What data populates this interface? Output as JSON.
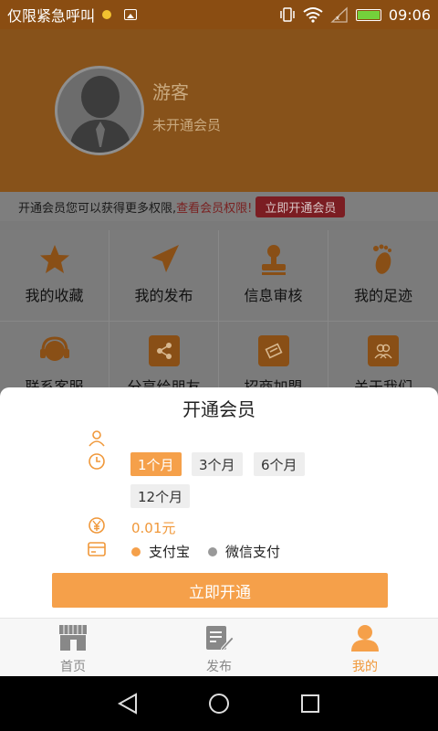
{
  "status_bar": {
    "notification_text": "仅限紧急呼叫",
    "time": "09:06",
    "icons": [
      "notification-dot-icon",
      "image-icon",
      "vibrate-icon",
      "wifi-icon",
      "signal-icon",
      "battery-charging-icon"
    ]
  },
  "profile": {
    "name": "游客",
    "membership_status": "未开通会员"
  },
  "promo": {
    "text": "开通会员您可以获得更多权限,",
    "link": "查看会员权限!",
    "button": "立即开通会员"
  },
  "grid": {
    "items": [
      {
        "label": "我的收藏",
        "icon": "star-icon"
      },
      {
        "label": "我的发布",
        "icon": "send-arrow-icon"
      },
      {
        "label": "信息审核",
        "icon": "stamp-icon"
      },
      {
        "label": "我的足迹",
        "icon": "footprint-icon"
      },
      {
        "label": "联系客服",
        "icon": "headset-icon"
      },
      {
        "label": "分享给朋友",
        "icon": "share-icon"
      },
      {
        "label": "招商加盟",
        "icon": "handshake-icon"
      },
      {
        "label": "关于我们",
        "icon": "group-icon"
      }
    ]
  },
  "modal": {
    "title": "开通会员",
    "months": [
      "1个月",
      "3个月",
      "6个月",
      "12个月"
    ],
    "selected_month": "1个月",
    "price": "0.01元",
    "payment_options": [
      "支付宝",
      "微信支付"
    ],
    "selected_payment": "支付宝",
    "submit": "立即开通",
    "row_icons": [
      "user-icon",
      "clock-icon",
      "yen-icon",
      "card-icon"
    ]
  },
  "tabs": [
    {
      "label": "首页",
      "icon": "shop-icon",
      "active": false
    },
    {
      "label": "发布",
      "icon": "edit-icon",
      "active": false
    },
    {
      "label": "我的",
      "icon": "person-icon",
      "active": true
    }
  ],
  "colors": {
    "accent": "#f5a04a",
    "header": "#87521a",
    "promo_button": "#7b1d22",
    "inactive_dot": "#999999"
  }
}
